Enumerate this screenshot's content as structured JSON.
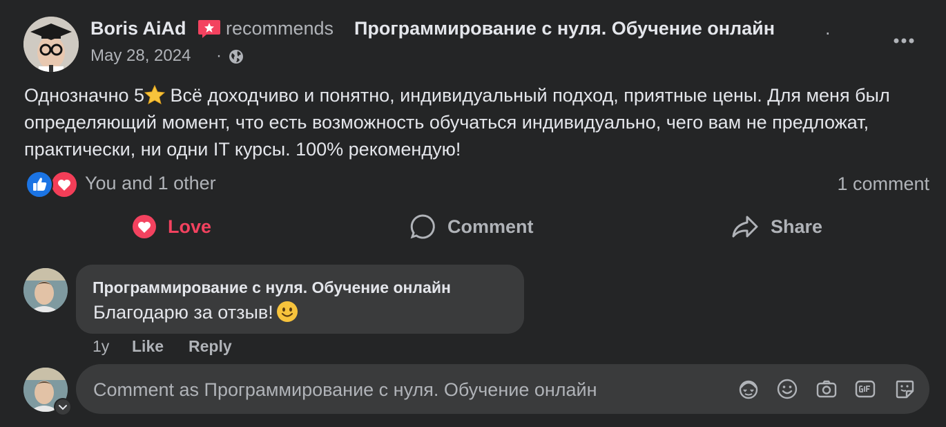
{
  "post": {
    "author": "Boris AiAd",
    "action_word": "recommends",
    "page_name": "Программирование с нуля. Обучение онлайн",
    "page_suffix": ".",
    "date": "May 28, 2024",
    "date_separator": "·",
    "text_before_star": "Однозначно 5",
    "text_after_star": " Всё доходчиво и понятно, индивидуальный подход, приятные цены. Для меня был определяющий момент, что есть возможность обучаться индивидуально, чего вам не предложат, практически, ни одни IT курсы. 100% рекомендую!",
    "reactions_summary": "You and 1 other",
    "comments_count": "1 comment"
  },
  "actions": {
    "love": "Love",
    "comment": "Comment",
    "share": "Share"
  },
  "comment": {
    "author": "Программирование с нуля. Обучение онлайн",
    "text": "Благодарю за отзыв!",
    "time": "1y",
    "like": "Like",
    "reply": "Reply"
  },
  "composer": {
    "placeholder": "Comment as Программирование с нуля. Обучение онлайн"
  },
  "icons": {
    "globe": "globe-icon",
    "more": "more-options-icon",
    "love_reaction": "heart-icon",
    "like_reaction": "thumbs-up-icon",
    "comment": "speech-bubble-icon",
    "share": "share-arrow-icon",
    "avatar_sticker": "avatar-icon",
    "emoji": "smiley-icon",
    "camera": "camera-icon",
    "gif": "gif-icon",
    "sticker": "sticker-icon"
  },
  "colors": {
    "background": "#242526",
    "bubble": "#3a3b3c",
    "primary_text": "#e4e6eb",
    "secondary_text": "#b0b3b8",
    "love": "#f3425f",
    "like": "#1b74e4"
  }
}
